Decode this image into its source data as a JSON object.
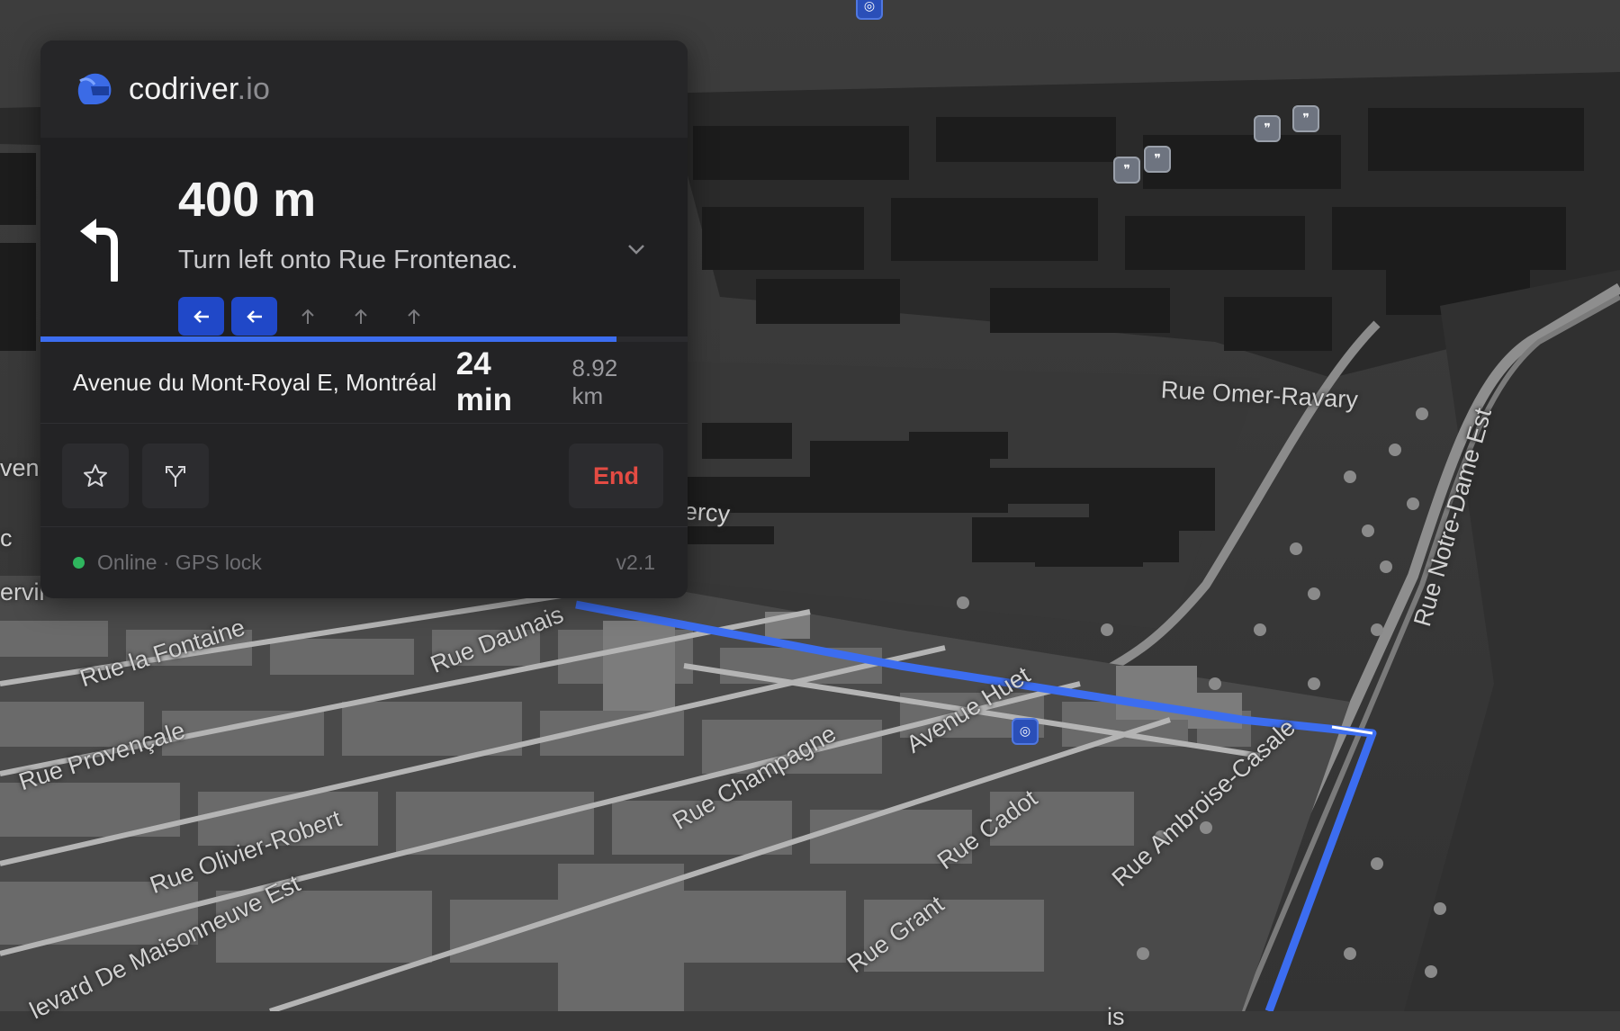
{
  "app": {
    "brand_name": "codriver",
    "brand_tld": ".io",
    "logo_icon": "helmet-icon"
  },
  "navigation": {
    "distance": "400 m",
    "instruction": "Turn left onto Rue Frontenac.",
    "maneuver_icon": "turn-left-icon",
    "lanes": [
      {
        "direction": "left",
        "active": true
      },
      {
        "direction": "left",
        "active": true
      },
      {
        "direction": "straight",
        "active": false
      },
      {
        "direction": "straight",
        "active": false
      },
      {
        "direction": "straight",
        "active": false
      }
    ],
    "progress_fraction": 0.89
  },
  "route": {
    "destination": "Avenue du Mont-Royal E, Montréal",
    "eta": "24 min",
    "distance": "8.92 km"
  },
  "actions": {
    "favorite_icon": "star-icon",
    "alternate_route_icon": "fork-route-icon",
    "end_label": "End"
  },
  "status": {
    "text": "Online · GPS lock",
    "version": "v2.1",
    "indicator_color": "#2fb55e"
  },
  "map": {
    "street_labels": [
      "Rue Omer-Ravary",
      "Rue Notre-Dame Est",
      "Rue la Fontaine",
      "Rue Daunais",
      "Rue Provençale",
      "Avenue Huet",
      "Rue Champagne",
      "Rue Olivier-Robert",
      "Rue Cadot",
      "Rue Ambroise-Casale",
      "levard De Maisonneuve Est",
      "Rue Grant",
      "ercy",
      "ven",
      "ervil",
      "c",
      "is"
    ],
    "route_color": "#3c6df0",
    "accent_color": "#2048c8"
  }
}
